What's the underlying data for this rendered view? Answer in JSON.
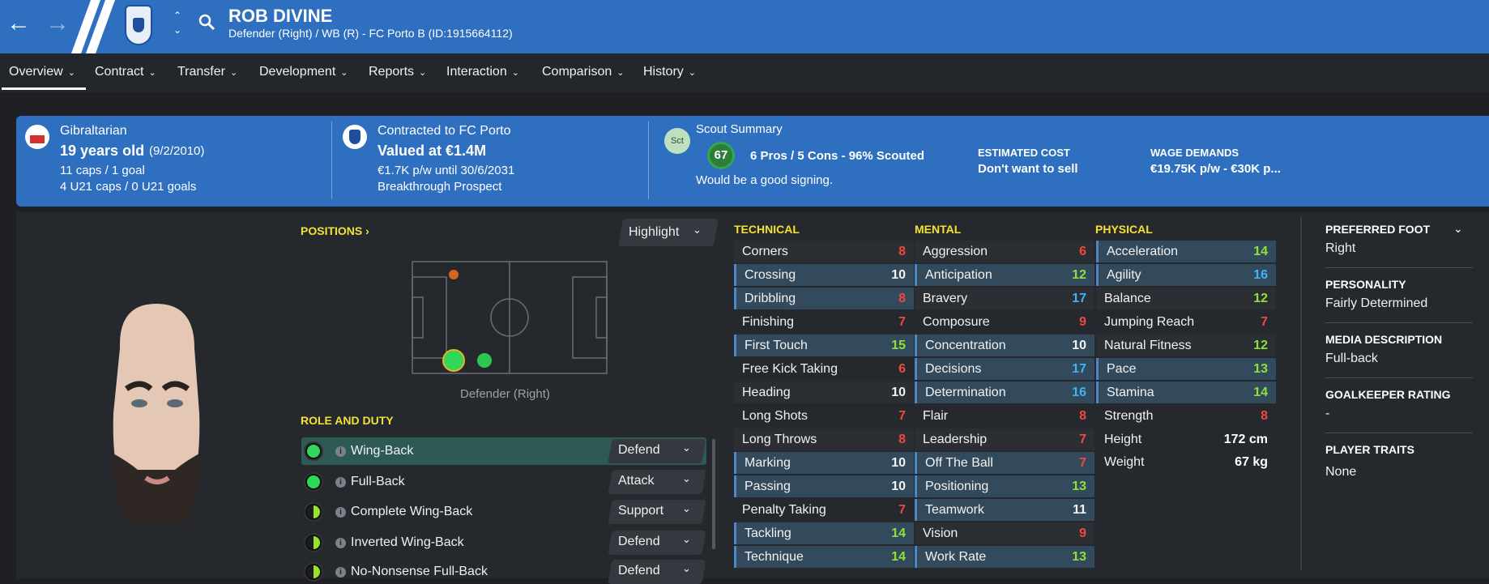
{
  "nav": {
    "back_icon": "arrow-left-icon",
    "forward_icon": "arrow-right-icon"
  },
  "header": {
    "name": "ROB DIVINE",
    "subtitle": "Defender (Right) / WB (R) - FC Porto B (ID:1915664112)"
  },
  "tabs": [
    "Overview",
    "Contract",
    "Transfer",
    "Development",
    "Reports",
    "Interaction",
    "Comparison",
    "History"
  ],
  "banner": {
    "nationality": "Gibraltarian",
    "age": "19 years old",
    "dob": "(9/2/2010)",
    "caps": "11 caps / 1 goal",
    "u21": "4 U21 caps / 0 U21 goals",
    "contract": "Contracted to FC Porto",
    "value": "Valued at €1.4M",
    "wage": "€1.7K p/w until 30/6/2031",
    "status": "Breakthrough Prospect",
    "scout_title": "Scout Summary",
    "scout_badge": "Sct",
    "scout_rating": "67",
    "scout_summary": "6 Pros / 5 Cons - 96% Scouted",
    "scout_note": "Would be a good signing.",
    "est_cost_label": "ESTIMATED COST",
    "est_cost": "Don't want to sell",
    "wage_label": "WAGE DEMANDS",
    "wage_demands": "€19.75K p/w - €30K p..."
  },
  "positions": {
    "title": "POSITIONS",
    "highlight": "Highlight",
    "label": "Defender (Right)"
  },
  "role": {
    "title": "ROLE AND DUTY",
    "rows": [
      {
        "name": "Wing-Back",
        "duty": "Defend"
      },
      {
        "name": "Full-Back",
        "duty": "Attack"
      },
      {
        "name": "Complete Wing-Back",
        "duty": "Support"
      },
      {
        "name": "Inverted Wing-Back",
        "duty": "Defend"
      },
      {
        "name": "No-Nonsense Full-Back",
        "duty": "Defend"
      }
    ]
  },
  "technical": {
    "title": "TECHNICAL",
    "attrs": [
      {
        "n": "Corners",
        "v": "8"
      },
      {
        "n": "Crossing",
        "v": "10"
      },
      {
        "n": "Dribbling",
        "v": "8"
      },
      {
        "n": "Finishing",
        "v": "7"
      },
      {
        "n": "First Touch",
        "v": "15"
      },
      {
        "n": "Free Kick Taking",
        "v": "6"
      },
      {
        "n": "Heading",
        "v": "10"
      },
      {
        "n": "Long Shots",
        "v": "7"
      },
      {
        "n": "Long Throws",
        "v": "8"
      },
      {
        "n": "Marking",
        "v": "10"
      },
      {
        "n": "Passing",
        "v": "10"
      },
      {
        "n": "Penalty Taking",
        "v": "7"
      },
      {
        "n": "Tackling",
        "v": "14"
      },
      {
        "n": "Technique",
        "v": "14"
      }
    ]
  },
  "mental": {
    "title": "MENTAL",
    "attrs": [
      {
        "n": "Aggression",
        "v": "6"
      },
      {
        "n": "Anticipation",
        "v": "12"
      },
      {
        "n": "Bravery",
        "v": "17"
      },
      {
        "n": "Composure",
        "v": "9"
      },
      {
        "n": "Concentration",
        "v": "10"
      },
      {
        "n": "Decisions",
        "v": "17"
      },
      {
        "n": "Determination",
        "v": "16"
      },
      {
        "n": "Flair",
        "v": "8"
      },
      {
        "n": "Leadership",
        "v": "7"
      },
      {
        "n": "Off The Ball",
        "v": "7"
      },
      {
        "n": "Positioning",
        "v": "13"
      },
      {
        "n": "Teamwork",
        "v": "11"
      },
      {
        "n": "Vision",
        "v": "9"
      },
      {
        "n": "Work Rate",
        "v": "13"
      }
    ]
  },
  "physical": {
    "title": "PHYSICAL",
    "attrs": [
      {
        "n": "Acceleration",
        "v": "14"
      },
      {
        "n": "Agility",
        "v": "16"
      },
      {
        "n": "Balance",
        "v": "12"
      },
      {
        "n": "Jumping Reach",
        "v": "7"
      },
      {
        "n": "Natural Fitness",
        "v": "12"
      },
      {
        "n": "Pace",
        "v": "13"
      },
      {
        "n": "Stamina",
        "v": "14"
      },
      {
        "n": "Strength",
        "v": "8"
      }
    ],
    "height_label": "Height",
    "height": "172 cm",
    "weight_label": "Weight",
    "weight": "67 kg"
  },
  "side": {
    "foot_label": "PREFERRED FOOT",
    "foot": "Right",
    "personality_label": "PERSONALITY",
    "personality": "Fairly Determined",
    "media_label": "MEDIA DESCRIPTION",
    "media": "Full-back",
    "gk_label": "GOALKEEPER RATING",
    "gk": "-",
    "traits_label": "PLAYER TRAITS",
    "traits": "None"
  },
  "colors": {
    "red": "#f0493f",
    "white": "#f2f2f2",
    "blue": "#3fb5f5",
    "green": "#8ee03a",
    "yellow": "#f3e235",
    "accent": "#2f6fc0"
  }
}
